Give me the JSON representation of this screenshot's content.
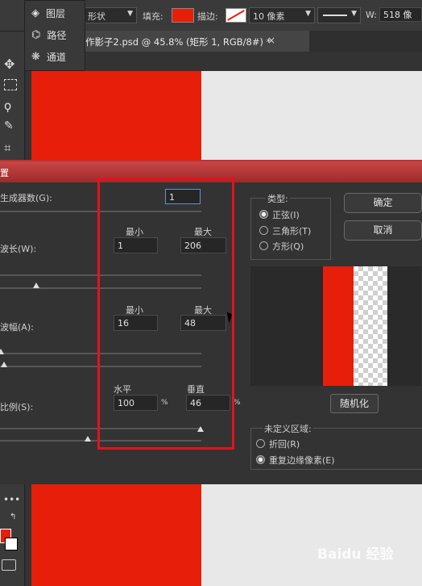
{
  "optbar": {
    "shape_mode": "形状",
    "fill_label": "填充:",
    "fill_color": "#e61e0a",
    "stroke_label": "描边:",
    "stroke_size": "10 像素",
    "width_label": "W:",
    "width_value": "518 像"
  },
  "panel": {
    "items": [
      "图层",
      "路径",
      "通道"
    ]
  },
  "tab": {
    "title": "作影子2.psd @ 45.8% (矩形 1, RGB/8#) *",
    "close": "×"
  },
  "dialog": {
    "title": "置",
    "generators_label": "生成器数(G):",
    "generators_value": "1",
    "wavelength_label": "波长(W):",
    "amplitude_label": "波幅(A):",
    "scale_label": "比例(S):",
    "min_label": "最小",
    "max_label": "最大",
    "wavelength_min": "1",
    "wavelength_max": "206",
    "amplitude_min": "16",
    "amplitude_max": "48",
    "horizontal_label": "水平",
    "vertical_label": "垂直",
    "scale_h": "100",
    "scale_v": "46",
    "percent": "%",
    "type_label": "类型:",
    "type_options": [
      "正弦(I)",
      "三角形(T)",
      "方形(Q)"
    ],
    "ok": "确定",
    "cancel": "取消",
    "randomize": "随机化",
    "undefined_label": "未定义区域:",
    "undefined_options": [
      "折回(R)",
      "重复边缘像素(E)"
    ]
  },
  "watermark": "Baidu 经验"
}
